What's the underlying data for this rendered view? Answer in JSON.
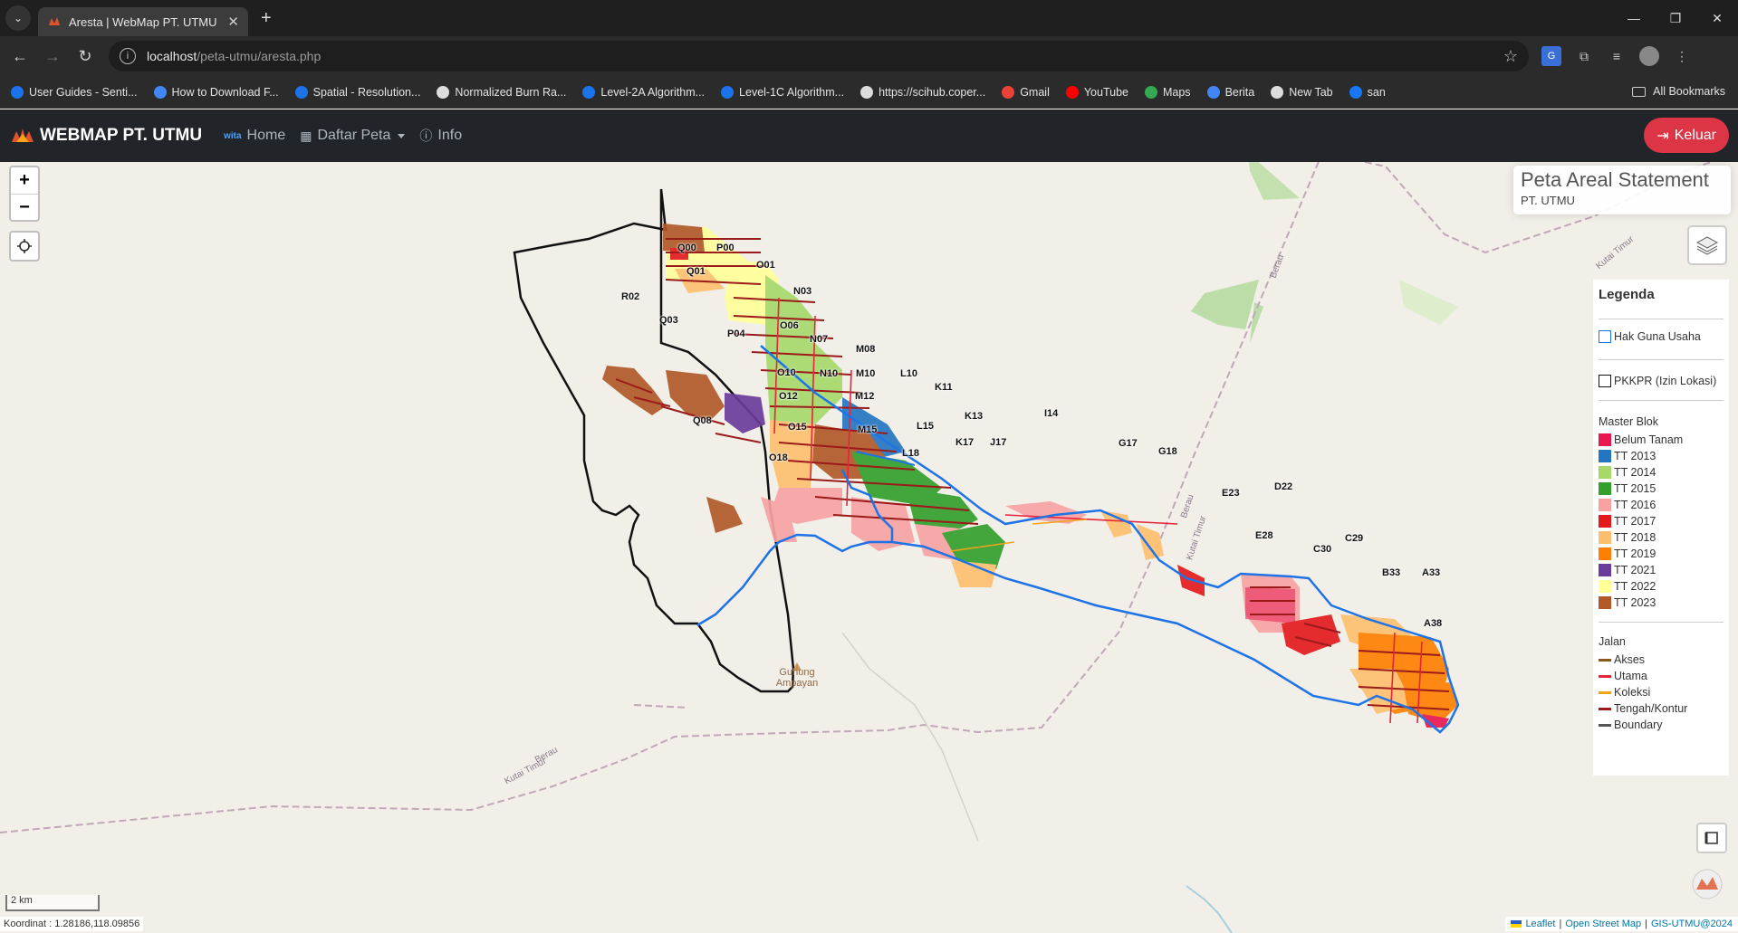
{
  "browser": {
    "tab_title": "Aresta | WebMap PT. UTMU",
    "url_host": "localhost",
    "url_path": "/peta-utmu/aresta.php",
    "bookmarks": [
      {
        "label": "User Guides - Senti...",
        "color": "#1a73e8"
      },
      {
        "label": "How to Download F...",
        "color": "#4285f4"
      },
      {
        "label": "Spatial - Resolution...",
        "color": "#1a73e8"
      },
      {
        "label": "Normalized Burn Ra...",
        "color": "#dddddd"
      },
      {
        "label": "Level-2A Algorithm...",
        "color": "#1a73e8"
      },
      {
        "label": "Level-1C Algorithm...",
        "color": "#1a73e8"
      },
      {
        "label": "https://scihub.coper...",
        "color": "#dddddd"
      },
      {
        "label": "Gmail",
        "color": "#ea4335"
      },
      {
        "label": "YouTube",
        "color": "#ff0000"
      },
      {
        "label": "Maps",
        "color": "#34a853"
      },
      {
        "label": "Berita",
        "color": "#4285f4"
      },
      {
        "label": "New Tab",
        "color": "#dddddd"
      },
      {
        "label": "san",
        "color": "#1877f2"
      }
    ],
    "all_bookmarks": "All Bookmarks"
  },
  "navbar": {
    "brand": "WEBMAP PT. UTMU",
    "wita": "wita",
    "home": "Home",
    "daftar_peta": "Daftar Peta",
    "info": "Info",
    "keluar": "Keluar"
  },
  "map": {
    "title": "Peta Areal Statement",
    "subtitle": "PT. UTMU",
    "scale": "2 km",
    "coordinate": "Koordinat : 1.28186,118.09856",
    "attribution": {
      "leaflet": "Leaflet",
      "osm": "Open Street Map",
      "gis": "GIS-UTMU@2024"
    },
    "place": "Gunung Ampayan",
    "road_labels": [
      "Berau",
      "Kutai Timur",
      "Berau",
      "Kutai Timur",
      "Berau",
      "Kutai Timur"
    ],
    "block_labels": [
      "Q00",
      "P00",
      "Q01",
      "O01",
      "R02",
      "N03",
      "Q03",
      "O06",
      "P04",
      "N07",
      "M08",
      "O10",
      "N10",
      "M10",
      "L10",
      "K11",
      "O12",
      "M12",
      "K13",
      "I14",
      "Q08",
      "O15",
      "M15",
      "L15",
      "K17",
      "J17",
      "G17",
      "G18",
      "L18",
      "O18",
      "E23",
      "D22",
      "E28",
      "C29",
      "C30",
      "B33",
      "A33",
      "A38"
    ]
  },
  "legend": {
    "title": "Legenda",
    "hgu": "Hak Guna Usaha",
    "pkkpr": "PKKPR (Izin Lokasi)",
    "master_blok": "Master Blok",
    "blocks": [
      {
        "label": "Belum Tanam",
        "color": "#e8174f"
      },
      {
        "label": "TT 2013",
        "color": "#2476c0"
      },
      {
        "label": "TT 2014",
        "color": "#a6d96a"
      },
      {
        "label": "TT 2015",
        "color": "#33a02c"
      },
      {
        "label": "TT 2016",
        "color": "#f8a2a2"
      },
      {
        "label": "TT 2017",
        "color": "#e31a1c"
      },
      {
        "label": "TT 2018",
        "color": "#fdbf6f"
      },
      {
        "label": "TT 2019",
        "color": "#ff7f00"
      },
      {
        "label": "TT 2021",
        "color": "#6a3d9a"
      },
      {
        "label": "TT 2022",
        "color": "#ffff99"
      },
      {
        "label": "TT 2023",
        "color": "#b15928"
      }
    ],
    "jalan": "Jalan",
    "roads": [
      {
        "label": "Akses",
        "color": "#8b5a1a"
      },
      {
        "label": "Utama",
        "color": "#e8233a"
      },
      {
        "label": "Koleksi",
        "color": "#f5a31a"
      },
      {
        "label": "Tengah/Kontur",
        "color": "#9b1a1a"
      },
      {
        "label": "Boundary",
        "color": "#555555"
      }
    ]
  }
}
